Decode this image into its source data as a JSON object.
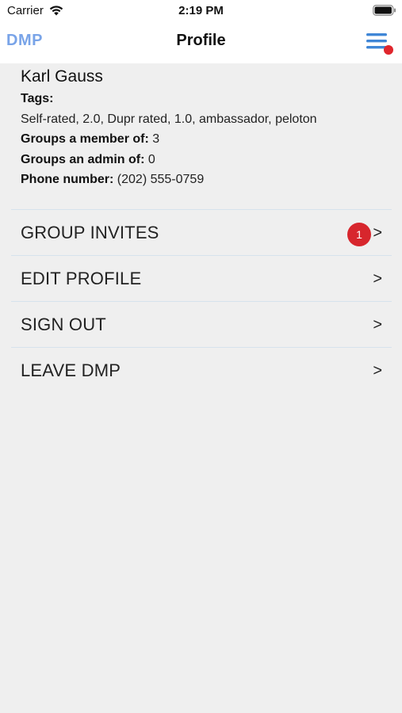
{
  "status_bar": {
    "carrier": "Carrier",
    "time": "2:19 PM"
  },
  "nav": {
    "logo": "DMP",
    "title": "Profile",
    "menu_icon": "hamburger-menu-icon",
    "notification_dot_color": "#e0262d"
  },
  "profile": {
    "name": "Karl Gauss",
    "tags_label": "Tags:",
    "tags_value": "Self-rated, 2.0, Dupr rated, 1.0, ambassador, peloton",
    "member_label": "Groups a member of:",
    "member_value": "3",
    "admin_label": "Groups an admin of:",
    "admin_value": "0",
    "phone_label": "Phone number:",
    "phone_value": "(202) 555-0759"
  },
  "menu": {
    "items": [
      {
        "label": "GROUP INVITES",
        "badge": "1",
        "chevron": ">"
      },
      {
        "label": "EDIT PROFILE",
        "chevron": ">"
      },
      {
        "label": "SIGN OUT",
        "chevron": ">"
      },
      {
        "label": "LEAVE DMP",
        "chevron": ">"
      }
    ]
  },
  "colors": {
    "accent": "#3f86d6",
    "logo": "#79a4e8",
    "badge": "#d7262d",
    "background": "#efefef",
    "divider": "#d6e2ec"
  }
}
